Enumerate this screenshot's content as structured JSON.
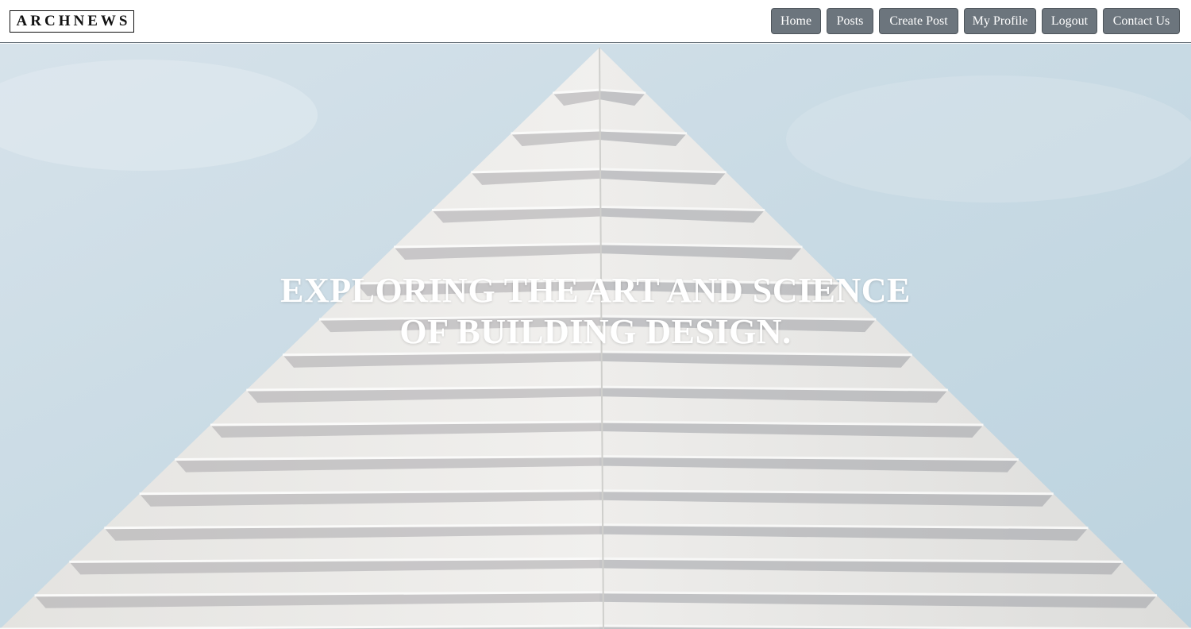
{
  "header": {
    "logo_text": "ARCHNEWS",
    "nav": [
      {
        "label": "Home"
      },
      {
        "label": "Posts"
      },
      {
        "label": "Create Post"
      },
      {
        "label": "My Profile"
      },
      {
        "label": "Logout"
      },
      {
        "label": "Contact Us"
      }
    ]
  },
  "hero": {
    "headline_line1": "EXPLORING THE ART AND SCIENCE",
    "headline_line2": "OF BUILDING DESIGN.",
    "image_subject": "white modular concrete building facade against pale blue sky"
  },
  "colors": {
    "nav_button_bg": "#6c757d",
    "nav_button_text": "#ffffff",
    "sky": "#c6d8e3",
    "facade": "#ecebe8",
    "headline": "#ffffff"
  }
}
